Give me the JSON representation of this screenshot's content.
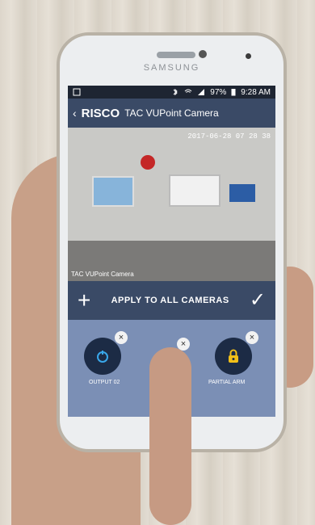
{
  "device": {
    "brand": "SAMSUNG"
  },
  "status_bar": {
    "battery": "97%",
    "time": "9:28 AM"
  },
  "app_bar": {
    "logo": "RISCO",
    "title": "TAC VUPoint Camera"
  },
  "video": {
    "timestamp": "2017-06-28 07 28 38",
    "camera_label": "TAC VUPoint Camera"
  },
  "controls": {
    "add": "+",
    "apply_all": "APPLY TO ALL CAMERAS",
    "confirm": "✓"
  },
  "tiles": [
    {
      "label": "OUTPUT 02",
      "icon": "output-icon",
      "close": "×"
    },
    {
      "label": "",
      "icon": "hidden-icon",
      "close": "×"
    },
    {
      "label": "PARTIAL ARM",
      "icon": "partial-arm-lock-icon",
      "close": "×"
    }
  ],
  "colors": {
    "app_bar": "#3a4a66",
    "tray": "#7b8fb5",
    "tile": "#1c2b45",
    "arm_yellow": "#f2c018"
  }
}
